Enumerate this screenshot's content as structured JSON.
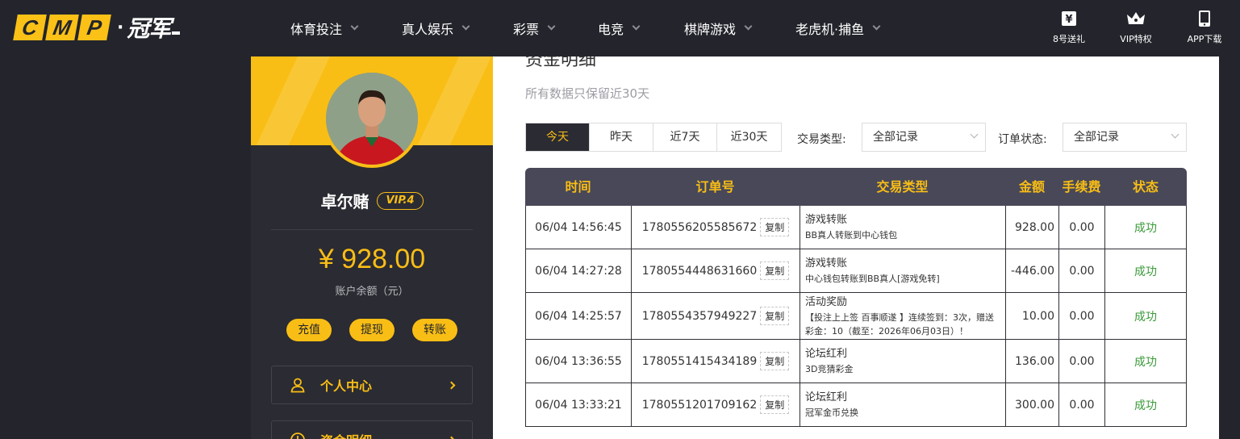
{
  "brand": {
    "logo_letters": [
      "C",
      "M",
      "P"
    ],
    "logo_cn": "冠军",
    "accent_color": "#f9be15",
    "dark_color": "#24252c"
  },
  "nav": {
    "items": [
      {
        "label": "体育投注"
      },
      {
        "label": "真人娱乐"
      },
      {
        "label": "彩票"
      },
      {
        "label": "电竞"
      },
      {
        "label": "棋牌游戏"
      },
      {
        "label": "老虎机·捕鱼"
      }
    ],
    "right_icons": [
      {
        "label": "8号送礼",
        "icon": "gift-box-icon"
      },
      {
        "label": "VIP特权",
        "icon": "crown-icon"
      },
      {
        "label": "APP下载",
        "icon": "phone-icon"
      }
    ]
  },
  "profile": {
    "username": "卓尔赌",
    "vip_level": "VIP.4",
    "balance": "¥ 928.00",
    "balance_label": "账户余额（元）",
    "actions": [
      {
        "label": "充值"
      },
      {
        "label": "提现"
      },
      {
        "label": "转账"
      }
    ],
    "menu": [
      {
        "label": "个人中心",
        "icon": "user-icon"
      },
      {
        "label": "资金明细",
        "icon": "clock-icon"
      }
    ]
  },
  "main": {
    "title": "资金明细",
    "note": "所有数据只保留近30天",
    "ranges": [
      {
        "label": "今天",
        "active": true
      },
      {
        "label": "昨天",
        "active": false
      },
      {
        "label": "近7天",
        "active": false
      },
      {
        "label": "近30天",
        "active": false
      }
    ],
    "filters": {
      "type_label": "交易类型:",
      "type_value": "全部记录",
      "status_label": "订单状态:",
      "status_value": "全部记录"
    },
    "table": {
      "headers": [
        "时间",
        "订单号",
        "交易类型",
        "金额",
        "手续费",
        "状态"
      ],
      "copy_label": "复制",
      "rows": [
        {
          "time": "06/04 14:56:45",
          "order": "1780556205585672",
          "type": "游戏转账",
          "detail": "BB真人转账到中心钱包",
          "amount": "928.00",
          "fee": "0.00",
          "status": "成功"
        },
        {
          "time": "06/04 14:27:28",
          "order": "1780554448631660",
          "type": "游戏转账",
          "detail": "中心钱包转账到BB真人[游戏免转]",
          "amount": "-446.00",
          "fee": "0.00",
          "status": "成功"
        },
        {
          "time": "06/04 14:25:57",
          "order": "1780554357949227",
          "type": "活动奖励",
          "detail": "【投注上上签 百事顺遂 】连续签到：3次，赠送彩金：10（截至：2026年06月03日）！",
          "amount": "10.00",
          "fee": "0.00",
          "status": "成功"
        },
        {
          "time": "06/04 13:36:55",
          "order": "1780551415434189",
          "type": "论坛红利",
          "detail": "3D竞猜彩金",
          "amount": "136.00",
          "fee": "0.00",
          "status": "成功"
        },
        {
          "time": "06/04 13:33:21",
          "order": "1780551201709162",
          "type": "论坛红利",
          "detail": "冠军金币兑换",
          "amount": "300.00",
          "fee": "0.00",
          "status": "成功"
        }
      ]
    }
  }
}
